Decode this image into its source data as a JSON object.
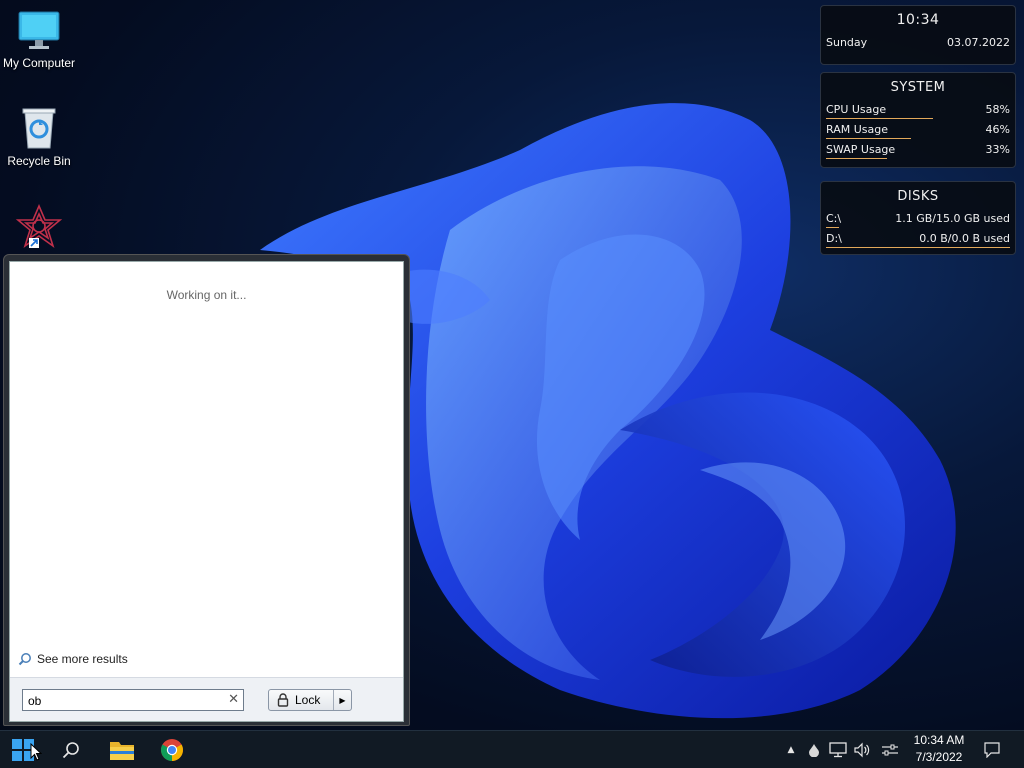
{
  "desktop": {
    "icons": [
      {
        "label": "My Computer",
        "icon": "monitor-icon"
      },
      {
        "label": "Recycle Bin",
        "icon": "recycle-bin-icon"
      },
      {
        "label": "",
        "icon": "app-shortcut-icon"
      }
    ]
  },
  "widgets": {
    "clock": {
      "time": "10:34",
      "day": "Sunday",
      "date": "03.07.2022"
    },
    "system": {
      "title": "SYSTEM",
      "rows": [
        {
          "label": "CPU Usage",
          "value": "58%",
          "level": 0.58
        },
        {
          "label": "RAM Usage",
          "value": "46%",
          "level": 0.46
        },
        {
          "label": "SWAP Usage",
          "value": "33%",
          "level": 0.33
        }
      ]
    },
    "disks": {
      "title": "DISKS",
      "rows": [
        {
          "label": "C:\\",
          "value": "1.1 GB/15.0 GB used",
          "level": 0.07
        },
        {
          "label": "D:\\",
          "value": "0.0 B/0.0 B used",
          "level": 1.0
        }
      ]
    },
    "accent": "#e2a85a"
  },
  "start_menu": {
    "status": "Working on it...",
    "see_more": "See more results",
    "search_value": "ob",
    "lock_label": "Lock"
  },
  "taskbar": {
    "pinned": [
      "windows-start-icon",
      "search-icon",
      "file-explorer-icon",
      "chrome-icon"
    ],
    "tray": [
      "chevron-up-icon",
      "droplet-icon",
      "network-icon",
      "volume-icon",
      "settings-sliders-icon"
    ],
    "time": "10:34 AM",
    "date": "7/3/2022"
  }
}
